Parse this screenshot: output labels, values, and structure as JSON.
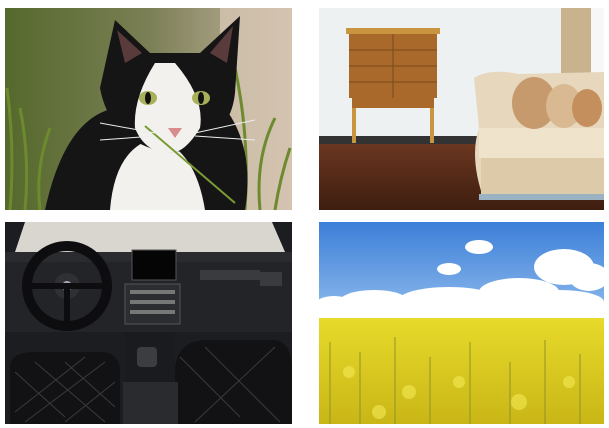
{
  "gallery": {
    "images": [
      {
        "subject": "cat-icon"
      },
      {
        "subject": "furniture-room-icon"
      },
      {
        "subject": "car-interior-icon"
      },
      {
        "subject": "rapeseed-field-icon"
      }
    ]
  },
  "colors": {
    "cat_fur_dark": "#141414",
    "cat_fur_white": "#f2f1ee",
    "grass_green": "#5f7a2c",
    "wall": "#eef1f2",
    "wood_floor": "#5a2e1a",
    "dresser": "#a8692b",
    "sofa": "#e7d7bd",
    "car_dark": "#1c1d20",
    "sky_blue": "#4f8fe0",
    "rapeseed_yellow": "#e3d51e"
  }
}
